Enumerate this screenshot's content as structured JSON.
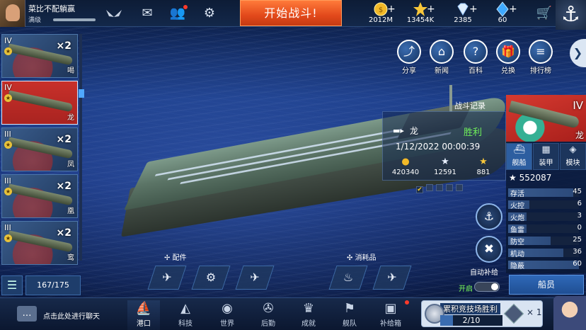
{
  "player": {
    "name": "菜比不配躺赢",
    "level": "满级"
  },
  "top": {
    "start_label": "开始战斗!",
    "resources": [
      {
        "icon": "gold-coin-icon",
        "value": "2012M"
      },
      {
        "icon": "star-icon",
        "value": "13454K"
      },
      {
        "icon": "diamond-icon",
        "value": "2385"
      },
      {
        "icon": "blue-crystal-icon",
        "value": "60"
      }
    ]
  },
  "side_menu": [
    {
      "icon": "share-icon",
      "label": "分享"
    },
    {
      "icon": "news-icon",
      "label": "新闻"
    },
    {
      "icon": "wiki-icon",
      "label": "百科"
    },
    {
      "icon": "redeem-icon",
      "label": "兑换"
    },
    {
      "icon": "ranking-icon",
      "label": "排行榜"
    }
  ],
  "ship_list": {
    "items": [
      {
        "tier": "IV",
        "count": "×2",
        "name": "喝",
        "selected": false
      },
      {
        "tier": "IV",
        "count": "",
        "name": "龙",
        "selected": true
      },
      {
        "tier": "III",
        "count": "×2",
        "name": "凤",
        "selected": false
      },
      {
        "tier": "III",
        "count": "×2",
        "name": "凰",
        "selected": false
      },
      {
        "tier": "III",
        "count": "×2",
        "name": "鸾",
        "selected": false
      }
    ],
    "dock_count": "167/175"
  },
  "battle_record": {
    "title": "战斗记录",
    "ship_name": "龙",
    "result": "胜利",
    "datetime": "1/12/2022 00:00:39",
    "stats": [
      {
        "icon": "gold-coin-icon",
        "value": "420340"
      },
      {
        "icon": "star-icon",
        "value": "12591"
      },
      {
        "icon": "gold-star-icon",
        "value": "881"
      }
    ]
  },
  "ship_info": {
    "tier": "IV",
    "name": "龙",
    "tabs": [
      {
        "label": "舰船",
        "active": true
      },
      {
        "label": "装甲",
        "active": false
      },
      {
        "label": "模块",
        "active": false
      }
    ],
    "score": "552087",
    "stats": [
      {
        "label": "存活",
        "value": "45",
        "fill": 0.45
      },
      {
        "label": "火控",
        "value": "6",
        "fill": 0.06
      },
      {
        "label": "火炮",
        "value": "3",
        "fill": 0.03
      },
      {
        "label": "鱼雷",
        "value": "0",
        "fill": 0.0
      },
      {
        "label": "防空",
        "value": "25",
        "fill": 0.25
      },
      {
        "label": "机动",
        "value": "36",
        "fill": 0.36
      },
      {
        "label": "隐蔽",
        "value": "60",
        "fill": 0.6
      }
    ],
    "crew_label": "船员"
  },
  "auto_supply": {
    "label": "自动补给",
    "toggle_label": "开启"
  },
  "parts_label": "配件",
  "consumables_label": "消耗品",
  "chat_hint": "点击此处进行聊天",
  "bottom_nav": [
    {
      "icon": "port-icon",
      "label": "港口",
      "active": true
    },
    {
      "icon": "tech-icon",
      "label": "科技",
      "active": false
    },
    {
      "icon": "world-icon",
      "label": "世界",
      "active": false
    },
    {
      "icon": "logistics-icon",
      "label": "后勤",
      "active": false
    },
    {
      "icon": "achievement-icon",
      "label": "成就",
      "active": false
    },
    {
      "icon": "fleet-icon",
      "label": "舰队",
      "active": false
    },
    {
      "icon": "supply-box-icon",
      "label": "补给箱",
      "active": false
    }
  ],
  "arena": {
    "title": "累积竞技场胜利",
    "progress": "2/10",
    "progress_fraction": 0.2,
    "reward_mult": "× 1"
  }
}
